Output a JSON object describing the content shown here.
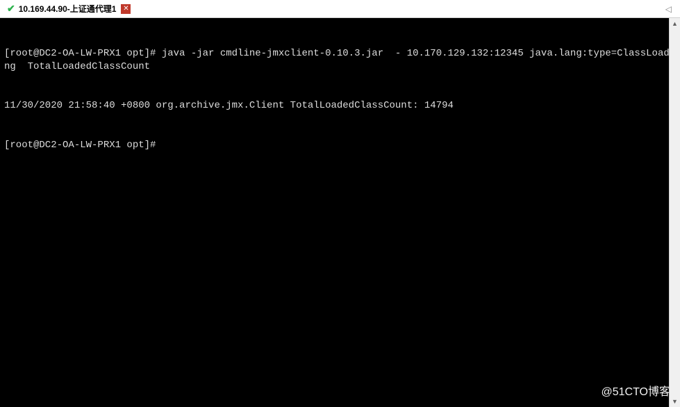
{
  "tab": {
    "title": "10.169.44.90-上证通代理1",
    "close_glyph": "✕",
    "check_glyph": "✔",
    "right_glyph": "◁"
  },
  "terminal": {
    "lines": [
      "[root@DC2-OA-LW-PRX1 opt]# java -jar cmdline-jmxclient-0.10.3.jar  - 10.170.129.132:12345 java.lang:type=ClassLoading  TotalLoadedClassCount",
      "11/30/2020 21:58:40 +0800 org.archive.jmx.Client TotalLoadedClassCount: 14794",
      "[root@DC2-OA-LW-PRX1 opt]# "
    ]
  },
  "watermark": "@51CTO博客",
  "scrollbar": {
    "up_glyph": "▲",
    "down_glyph": "▼"
  }
}
